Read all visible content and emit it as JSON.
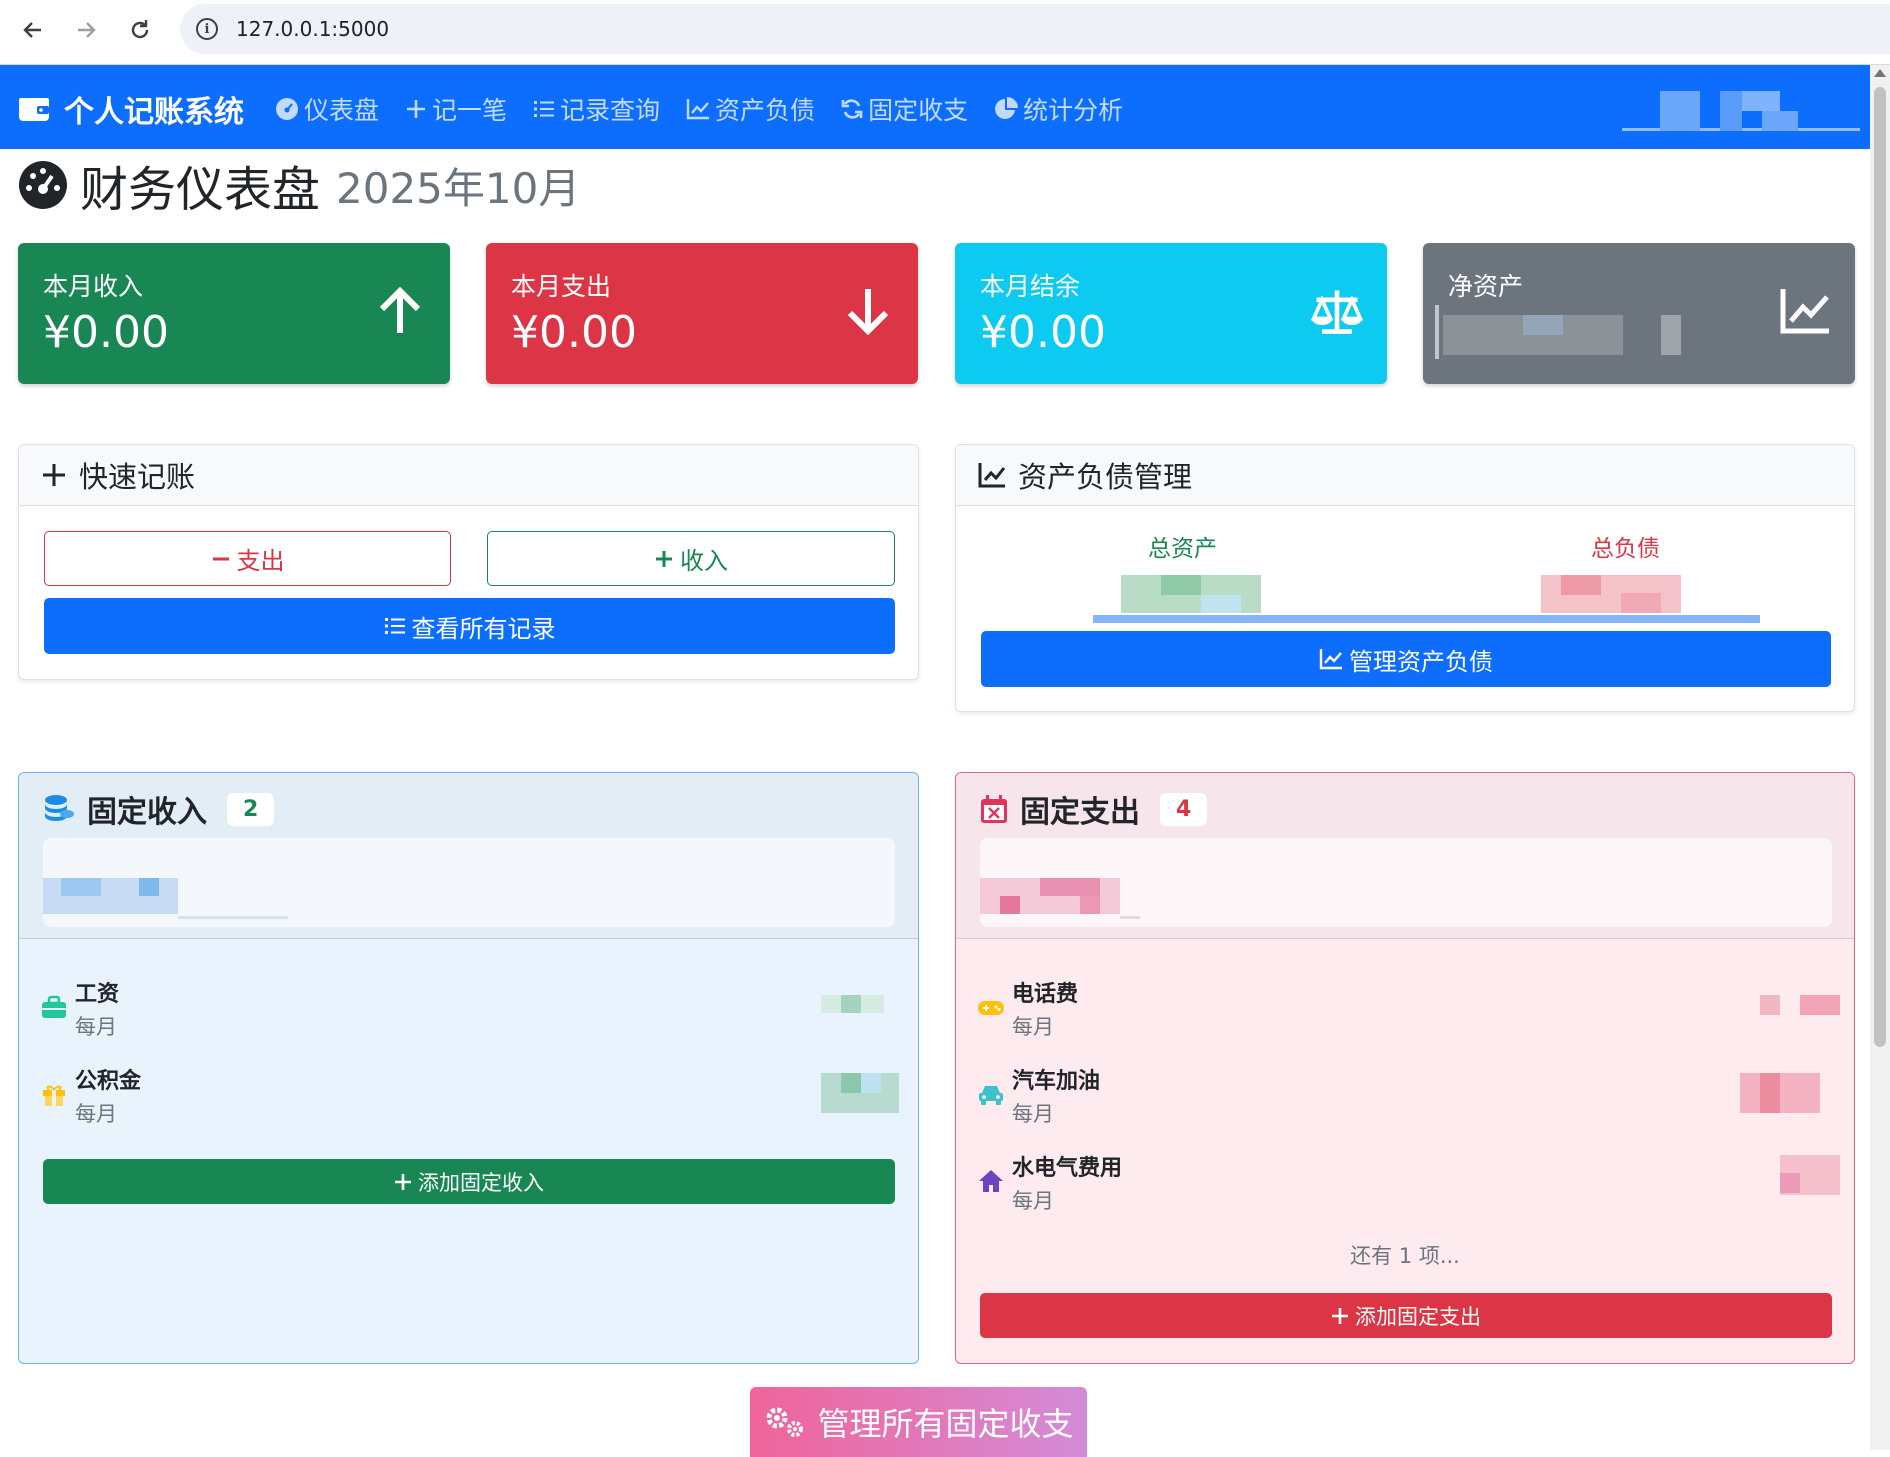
{
  "browser": {
    "url": "127.0.0.1:5000"
  },
  "navbar": {
    "brand": "个人记账系统",
    "items": [
      {
        "label": "仪表盘",
        "icon": "dashboard-icon"
      },
      {
        "label": "记一笔",
        "icon": "plus-icon"
      },
      {
        "label": "记录查询",
        "icon": "list-icon"
      },
      {
        "label": "资产负债",
        "icon": "chart-line-icon"
      },
      {
        "label": "固定收支",
        "icon": "sync-icon"
      },
      {
        "label": "统计分析",
        "icon": "pie-chart-icon"
      }
    ]
  },
  "page": {
    "title": "财务仪表盘",
    "month": "2025年10月"
  },
  "stats": {
    "income": {
      "label": "本月收入",
      "value": "¥0.00",
      "color": "#198754"
    },
    "expense": {
      "label": "本月支出",
      "value": "¥0.00",
      "color": "#dc3545"
    },
    "balance": {
      "label": "本月结余",
      "value": "¥0.00",
      "color": "#0dcaf0"
    },
    "net_assets": {
      "label": "净资产",
      "color": "#6c757d"
    }
  },
  "quick": {
    "title": "快速记账",
    "expense_btn": "支出",
    "income_btn": "收入",
    "view_all_btn": "查看所有记录"
  },
  "assets": {
    "title": "资产负债管理",
    "total_assets_label": "总资产",
    "total_liabilities_label": "总负债",
    "manage_btn": "管理资产负债"
  },
  "fixed_income": {
    "title": "固定收入",
    "count": "2",
    "items": [
      {
        "name": "工资",
        "freq": "每月",
        "icon": "briefcase-icon"
      },
      {
        "name": "公积金",
        "freq": "每月",
        "icon": "gift-icon"
      }
    ],
    "add_btn": "添加固定收入"
  },
  "fixed_expense": {
    "title": "固定支出",
    "count": "4",
    "items": [
      {
        "name": "电话费",
        "freq": "每月",
        "icon": "gamepad-icon"
      },
      {
        "name": "汽车加油",
        "freq": "每月",
        "icon": "car-icon"
      },
      {
        "name": "水电气费用",
        "freq": "每月",
        "icon": "home-icon"
      }
    ],
    "more": "还有 1 项...",
    "add_btn": "添加固定支出"
  },
  "manage_all_btn": "管理所有固定收支"
}
